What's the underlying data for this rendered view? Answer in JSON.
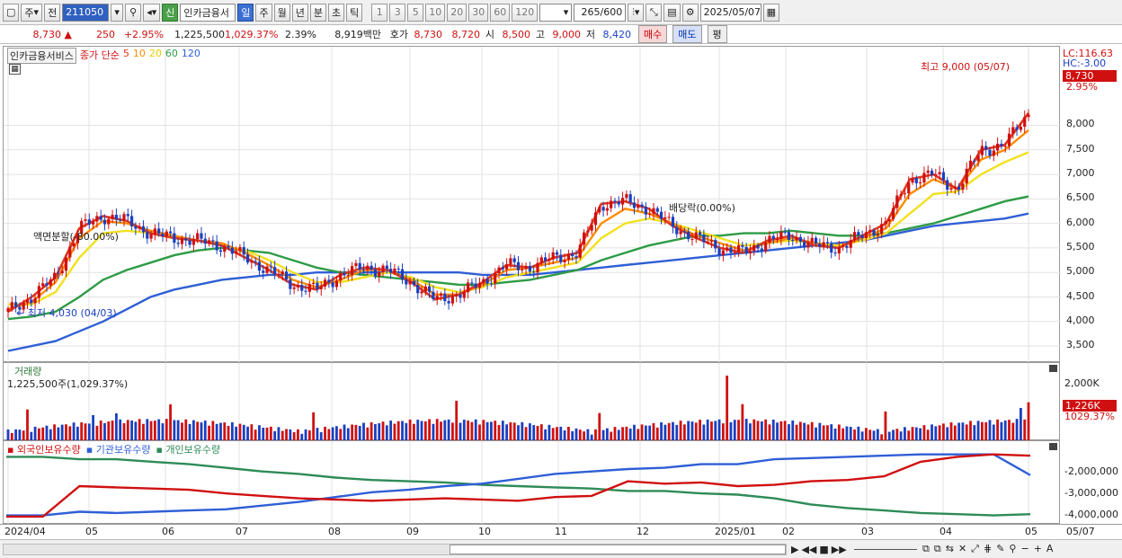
{
  "toolbar": {
    "market": "주",
    "all_label": "전",
    "code": "211050",
    "new_badge": "신",
    "stock_name": "인카금융서",
    "period_tabs": [
      "일",
      "주",
      "월",
      "년",
      "분",
      "초",
      "틱"
    ],
    "multiples": [
      "1",
      "3",
      "5",
      "10",
      "20",
      "30",
      "60",
      "120"
    ],
    "count": "265",
    "count_max": "/600",
    "date": "2025/05/07"
  },
  "quote": {
    "price": "8,730",
    "change": "250",
    "change_pct": "+2.95%",
    "volume": "1,225,500",
    "volume_ratio": "1,029.37%",
    "turnover": "2.39%",
    "amount": "8,919백만",
    "bid_label": "호가",
    "ask": "8,730",
    "bid": "8,720",
    "open_label": "시",
    "open": "8,500",
    "high_label": "고",
    "high": "9,000",
    "low_label": "저",
    "low": "8,420",
    "buy": "매수",
    "sell": "매도",
    "eval": "평"
  },
  "price_pane": {
    "name": "인카금융서비스",
    "ma_label": "종가 단순",
    "ma_periods": [
      "5",
      "10",
      "20",
      "60",
      "120"
    ],
    "ma_colors": {
      "5": "#e03a1e",
      "10": "#ff8c00",
      "20": "#f2e01e",
      "60": "#2e9b46",
      "120": "#2f5fd6"
    },
    "annot_high": "최고 9,000 (05/07)",
    "annot_low": "최저 4,030 (04/03)",
    "annot_split": "액면분할(-80.00%)",
    "annot_div": "배당락(0.00%)",
    "lc": "LC:116.63",
    "hc": "HC:-3.00",
    "last_price": "8,730",
    "last_pct": "2.95%",
    "y_labels": [
      "8,000",
      "7,500",
      "7,000",
      "6,500",
      "6,000",
      "5,500",
      "5,000",
      "4,500",
      "4,000",
      "3,500"
    ]
  },
  "volume_pane": {
    "name": "거래량",
    "value": "1,225,500주(1,029.37%)",
    "y_label": "2,000K",
    "last": "1,226K",
    "last_pct": "1029.37%"
  },
  "holding_pane": {
    "series": [
      {
        "name": "외국인보유수량",
        "color": "#d01010"
      },
      {
        "name": "기관보유수량",
        "color": "#2f5fd6"
      },
      {
        "name": "개인보유수량",
        "color": "#2e8b57"
      }
    ],
    "y_labels": [
      "-2,000,000",
      "-3,000,000",
      "-4,000,000"
    ]
  },
  "x_axis": [
    "2024/04",
    "05",
    "06",
    "07",
    "08",
    "09",
    "10",
    "11",
    "12",
    "2025/01",
    "02",
    "03",
    "04",
    "05",
    "05/07"
  ],
  "chart_data": {
    "type": "candlestick",
    "title": "인카금융서비스",
    "ylim": [
      3300,
      9200
    ],
    "ma": {
      "5": [
        4200,
        4500,
        4900,
        5900,
        6150,
        6050,
        5800,
        5700,
        5650,
        5550,
        5300,
        5050,
        4750,
        4650,
        4950,
        5100,
        5050,
        4800,
        4450,
        4550,
        4800,
        5150,
        5100,
        5300,
        5400,
        6400,
        6450,
        6300,
        5950,
        5700,
        5500,
        5400,
        5650,
        5750,
        5550,
        5500,
        5750,
        6000,
        6900,
        7000,
        6700,
        7500,
        7600,
        8250
      ],
      "10": [
        4250,
        4400,
        4800,
        5700,
        6050,
        6000,
        5850,
        5750,
        5650,
        5600,
        5400,
        5150,
        4850,
        4700,
        4850,
        5050,
        5050,
        4850,
        4550,
        4550,
        4750,
        5050,
        5100,
        5200,
        5300,
        6000,
        6300,
        6200,
        6000,
        5750,
        5600,
        5450,
        5600,
        5700,
        5600,
        5500,
        5700,
        5900,
        6600,
        6900,
        6700,
        7300,
        7500,
        7900
      ],
      "20": [
        4350,
        4350,
        4600,
        5300,
        5800,
        5850,
        5800,
        5700,
        5650,
        5550,
        5450,
        5250,
        5000,
        4800,
        4800,
        4900,
        5000,
        4900,
        4700,
        4600,
        4700,
        4900,
        5000,
        5100,
        5200,
        5700,
        6000,
        6100,
        6000,
        5850,
        5700,
        5550,
        5600,
        5650,
        5600,
        5550,
        5650,
        5800,
        6200,
        6600,
        6650,
        7000,
        7250,
        7450
      ],
      "60": [
        4050,
        4100,
        4200,
        4500,
        4850,
        5050,
        5200,
        5350,
        5450,
        5500,
        5450,
        5400,
        5250,
        5100,
        5000,
        4950,
        4900,
        4850,
        4800,
        4750,
        4750,
        4800,
        4850,
        4950,
        5050,
        5250,
        5400,
        5550,
        5650,
        5750,
        5750,
        5800,
        5800,
        5850,
        5800,
        5750,
        5750,
        5800,
        5900,
        6000,
        6150,
        6300,
        6450,
        6550
      ],
      "120": [
        3400,
        3500,
        3600,
        3800,
        4000,
        4250,
        4500,
        4650,
        4750,
        4850,
        4900,
        4950,
        4950,
        5000,
        5000,
        5000,
        5000,
        5000,
        5000,
        5000,
        4950,
        4950,
        4950,
        5000,
        5050,
        5100,
        5150,
        5200,
        5250,
        5300,
        5350,
        5400,
        5450,
        5500,
        5550,
        5600,
        5650,
        5750,
        5850,
        5950,
        6000,
        6050,
        6100,
        6200
      ]
    },
    "holdings": {
      "foreign": [
        -4150000,
        -4150000,
        -2900000,
        -2950000,
        -3000000,
        -3050000,
        -3200000,
        -3300000,
        -3400000,
        -3450000,
        -3500000,
        -3450000,
        -3400000,
        -3450000,
        -3500000,
        -3350000,
        -3300000,
        -2700000,
        -2800000,
        -2750000,
        -2900000,
        -2850000,
        -2700000,
        -2650000,
        -2500000,
        -1900000,
        -1700000,
        -1600000,
        -1650000
      ],
      "inst": [
        -4100000,
        -4100000,
        -3950000,
        -4000000,
        -3950000,
        -3900000,
        -3850000,
        -3700000,
        -3550000,
        -3350000,
        -3150000,
        -3050000,
        -2900000,
        -2800000,
        -2600000,
        -2400000,
        -2300000,
        -2200000,
        -2150000,
        -2000000,
        -2000000,
        -1800000,
        -1750000,
        -1700000,
        -1650000,
        -1600000,
        -1600000,
        -1600000,
        -2450000
      ],
      "indiv": [
        -1700000,
        -1700000,
        -1800000,
        -1800000,
        -1900000,
        -2000000,
        -2150000,
        -2300000,
        -2400000,
        -2550000,
        -2650000,
        -2700000,
        -2750000,
        -2850000,
        -2900000,
        -2950000,
        -3000000,
        -3100000,
        -3100000,
        -3200000,
        -3250000,
        -3400000,
        -3650000,
        -3800000,
        -3900000,
        -4000000,
        -4050000,
        -4100000,
        -4050000
      ]
    }
  }
}
